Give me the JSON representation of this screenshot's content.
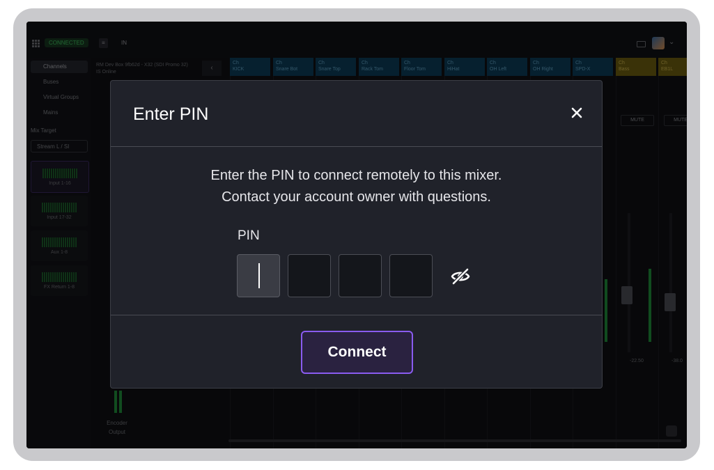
{
  "app": {
    "status": "CONNECTED",
    "tab_a": "≡",
    "tab_b": "IN",
    "breadcrumb_line1": "RM Dev Box 9fb62d - X32 (SDI Promo 32)",
    "breadcrumb_line2": "IS Online"
  },
  "sidebar": {
    "items": [
      {
        "label": "Channels",
        "active": true
      },
      {
        "label": "Buses"
      },
      {
        "label": "Virtual Groups"
      },
      {
        "label": "Mains"
      }
    ],
    "mix_target_label": "Mix Target",
    "mix_target_value": "Stream L / SI",
    "meters": [
      {
        "label": "Input 1-16",
        "active": true
      },
      {
        "label": "Input 17-32"
      },
      {
        "label": "Aux 1-8"
      },
      {
        "label": "FX Return 1-8"
      }
    ]
  },
  "channels": [
    {
      "num": "Ch",
      "name": "KICK",
      "color": "blue"
    },
    {
      "num": "Ch",
      "name": "Snare Bot",
      "color": "blue"
    },
    {
      "num": "Ch",
      "name": "Snare Top",
      "color": "blue"
    },
    {
      "num": "Ch",
      "name": "Rack Tom",
      "color": "blue"
    },
    {
      "num": "Ch",
      "name": "Floor Tom",
      "color": "blue"
    },
    {
      "num": "Ch",
      "name": "HiHat",
      "color": "blue"
    },
    {
      "num": "Ch",
      "name": "OH Left",
      "color": "blue"
    },
    {
      "num": "Ch",
      "name": "OH Right",
      "color": "blue"
    },
    {
      "num": "Ch",
      "name": "SPD-X",
      "color": "blue"
    },
    {
      "num": "Ch",
      "name": "Bass",
      "color": "yellow"
    },
    {
      "num": "Ch",
      "name": "EB1L",
      "color": "yellow"
    }
  ],
  "mute_label": "MUTE",
  "fader_values": [
    "-22.50",
    "-38.0"
  ],
  "encoder": {
    "line1": "Encoder",
    "line2": "Output"
  },
  "modal": {
    "title": "Enter PIN",
    "close_symbol": "×",
    "message_line1": "Enter the PIN to connect remotely to this mixer.",
    "message_line2": "Contact your account owner with questions.",
    "pin_label": "PIN",
    "pin_digits": [
      "",
      "",
      "",
      ""
    ],
    "connect_label": "Connect"
  },
  "colors": {
    "accent": "#8a5cf0",
    "modal_bg": "#20222a",
    "channel_blue": "#0b3b57",
    "channel_yellow": "#6a5b10"
  },
  "icons": {
    "close": "close-icon",
    "visibility": "eye-off-icon",
    "menu": "grid-icon"
  }
}
